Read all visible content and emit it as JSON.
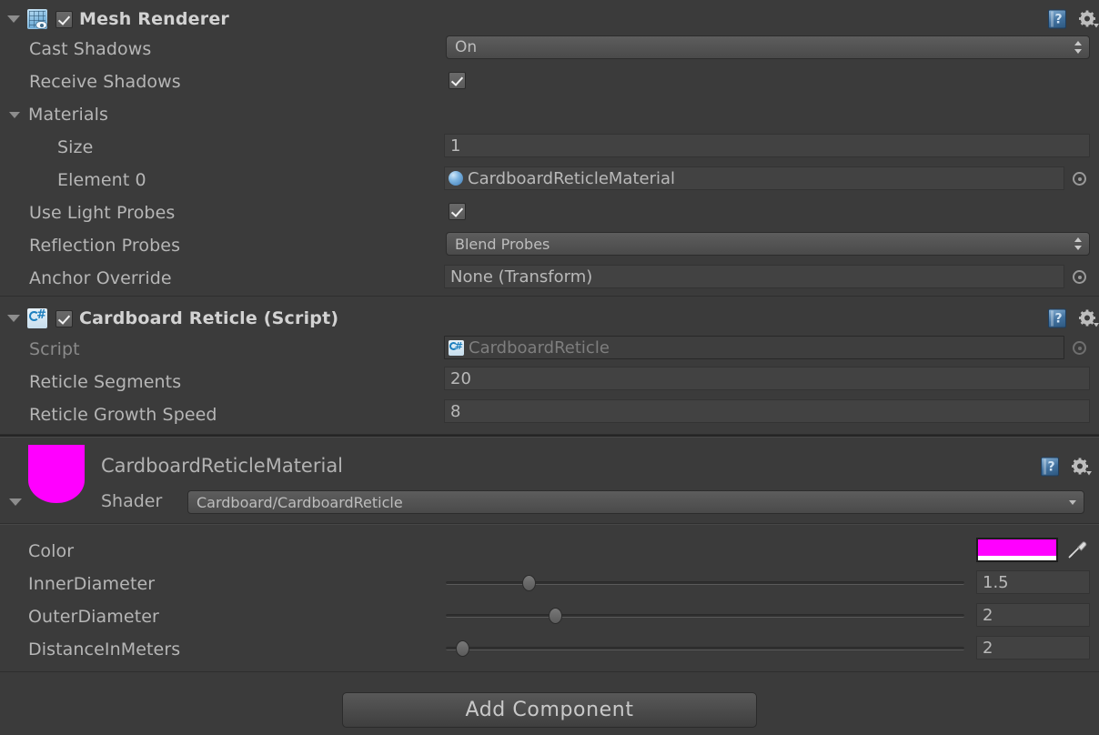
{
  "meta": {
    "bg_color": "#3b3b3b",
    "accent_magenta": "#ff00ff",
    "text_color": "#b6b6b6"
  },
  "mesh_renderer": {
    "title": "Mesh Renderer",
    "icon": "mesh-renderer-icon",
    "enabled": true,
    "expanded": true,
    "help_icon": "help-book-icon",
    "gear_icon": "gear-icon",
    "rows": [
      {
        "label": "Cast Shadows",
        "type": "popup",
        "value": "On"
      },
      {
        "label": "Receive Shadows",
        "type": "checkbox",
        "value": true
      },
      {
        "label": "Materials",
        "type": "foldout",
        "value": ""
      },
      {
        "label": "Size",
        "type": "text",
        "value": "1"
      },
      {
        "label": "Element 0",
        "type": "object",
        "value": "CardboardReticleMaterial",
        "icon": "material-sphere-icon"
      },
      {
        "label": "Use Light Probes",
        "type": "checkbox",
        "value": true
      },
      {
        "label": "Reflection Probes",
        "type": "popup",
        "value": "Blend Probes"
      },
      {
        "label": "Anchor Override",
        "type": "object",
        "value": "None (Transform)"
      }
    ]
  },
  "cardboard_reticle": {
    "title": "Cardboard Reticle (Script)",
    "icon": "csharp-script-icon",
    "enabled": true,
    "expanded": true,
    "help_icon": "help-book-icon",
    "gear_icon": "gear-icon",
    "rows": [
      {
        "label": "Script",
        "type": "object",
        "value": "CardboardReticle",
        "icon": "csharp-script-icon",
        "disabled": true
      },
      {
        "label": "Reticle Segments",
        "type": "text",
        "value": "20"
      },
      {
        "label": "Reticle Growth Speed",
        "type": "text",
        "value": "8"
      }
    ]
  },
  "material": {
    "name": "CardboardReticleMaterial",
    "preview_color": "#ff00ff",
    "help_icon": "help-book-icon",
    "gear_icon": "gear-icon",
    "shader_label": "Shader",
    "shader_value": "Cardboard/CardboardReticle",
    "properties": [
      {
        "label": "Color",
        "type": "color",
        "value": "#ff00ff",
        "eyedropper": "eyedropper-icon"
      },
      {
        "label": "InnerDiameter",
        "type": "slider",
        "value": "1.5",
        "fill": 0.16
      },
      {
        "label": "OuterDiameter",
        "type": "slider",
        "value": "2",
        "fill": 0.21
      },
      {
        "label": "DistanceInMeters",
        "type": "slider",
        "value": "2",
        "fill": 0.025
      }
    ]
  },
  "footer": {
    "add_component_label": "Add Component"
  }
}
